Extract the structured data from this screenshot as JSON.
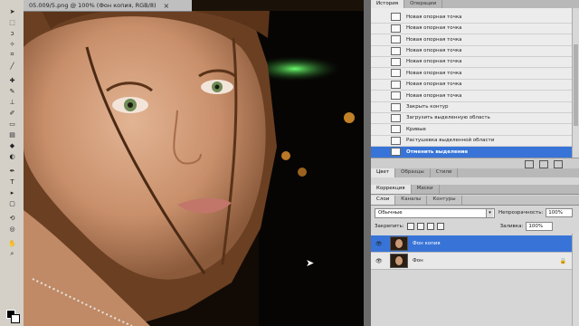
{
  "document": {
    "title": "05.009/5.png @ 100% (Фон копия, RGB/8)",
    "close_icon": "×"
  },
  "history_panel": {
    "tabs": [
      "История",
      "Операции"
    ],
    "items": [
      "Новая опорная точка",
      "Новая опорная точка",
      "Новая опорная точка",
      "Новая опорная точка",
      "Новая опорная точка",
      "Новая опорная точка",
      "Новая опорная точка",
      "Новая опорная точка",
      "Закрыть контур",
      "Загрузить выделенную область",
      "Кривые",
      "Растушевка выделенной области",
      "Отменить выделение"
    ],
    "selected_index": 12
  },
  "panel_tabs_2": [
    "Цвет",
    "Образцы",
    "Стили"
  ],
  "panel_tabs_3": [
    "Коррекция",
    "Маски"
  ],
  "layers_panel": {
    "tabs": [
      "Слои",
      "Каналы",
      "Контуры"
    ],
    "blend_mode": "Обычные",
    "opacity_label": "Непрозрачность:",
    "opacity_value": "100%",
    "lock_label": "Закрепить:",
    "fill_label": "Заливка:",
    "fill_value": "100%",
    "layers": [
      {
        "name": "Фон копия",
        "selected": true
      },
      {
        "name": "Фон",
        "selected": false,
        "locked": true
      }
    ]
  },
  "colors": {
    "selection_blue": "#3874d8",
    "panel_grey": "#d6d6d6"
  }
}
